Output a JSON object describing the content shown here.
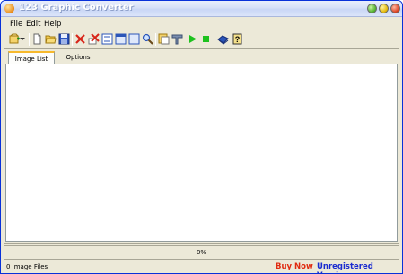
{
  "window": {
    "title": "123 Graphic Converter"
  },
  "menu": {
    "file": "File",
    "edit": "Edit",
    "help": "Help"
  },
  "toolbar": {
    "icons": [
      "add-files-icon",
      "dropdown-arrow-icon",
      "new-icon",
      "open-folder-icon",
      "save-icon",
      "delete-icon",
      "delete-all-icon",
      "list-view-icon",
      "details-view-icon",
      "thumbnail-view-icon",
      "search-icon",
      "select-icon",
      "paste-icon",
      "play-icon",
      "stop-icon",
      "book-icon",
      "help-icon"
    ]
  },
  "tabs": [
    {
      "label": "Image List",
      "active": true
    },
    {
      "label": "Options",
      "active": false
    }
  ],
  "progress": {
    "text": "0%",
    "value": 0
  },
  "status": {
    "files": "0 Image Files",
    "buy_now": "Buy Now",
    "registration": "Unregistered Version"
  },
  "colors": {
    "buy_now": "#e02a10",
    "registration": "#1a2bd0",
    "tab_highlight": "#f7b92c"
  }
}
